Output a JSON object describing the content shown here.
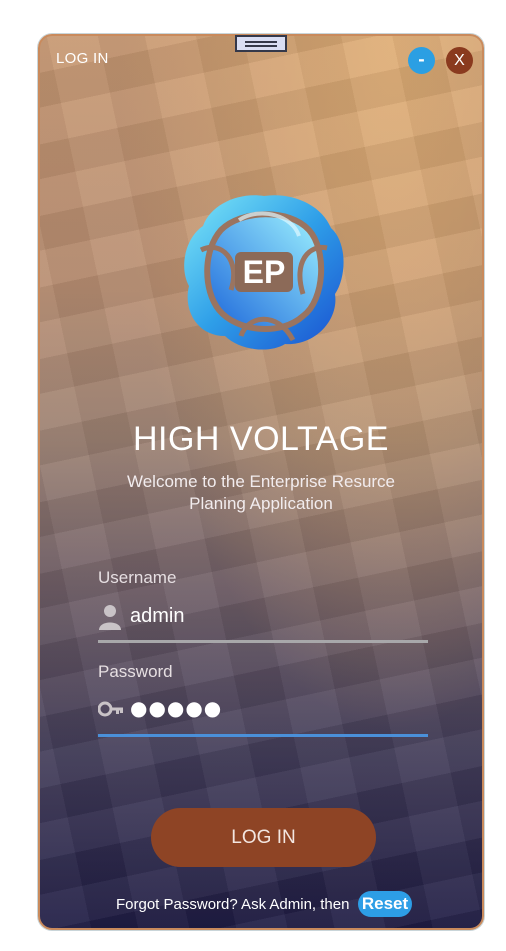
{
  "window": {
    "title": "LOG IN",
    "minimize_label": "-",
    "close_label": "X"
  },
  "brand": {
    "logo_icon": "erp-flower-logo-icon",
    "logo_text": "EP",
    "app_title": "HIGH VOLTAGE",
    "welcome_line1": "Welcome to the Enterprise Resurce",
    "welcome_line2": "Planing Application"
  },
  "form": {
    "username_label": "Username",
    "username_value": "admin",
    "username_icon": "user-icon",
    "password_label": "Password",
    "password_value": "●●●●●",
    "password_icon": "key-icon",
    "login_button": "LOG IN"
  },
  "footer": {
    "forgot_text": "Forgot Password? Ask Admin, then",
    "reset_button": "Reset"
  },
  "colors": {
    "accent_blue": "#2b9fe3",
    "login_button": "#8e4425",
    "close_button": "#8a3a1e",
    "active_underline": "#4a90d9"
  }
}
